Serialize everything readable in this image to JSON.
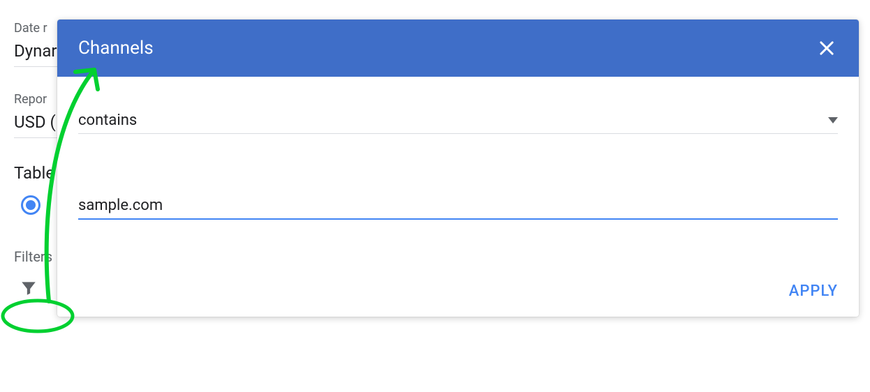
{
  "background": {
    "date_label": "Date r",
    "date_value": "Dynar",
    "report_label": "Repor",
    "report_value": "USD (",
    "table_label": "Table",
    "filters_label": "Filters"
  },
  "dialog": {
    "title": "Channels",
    "operator": "contains",
    "input_value": "sample.com",
    "apply_label": "APPLY"
  }
}
